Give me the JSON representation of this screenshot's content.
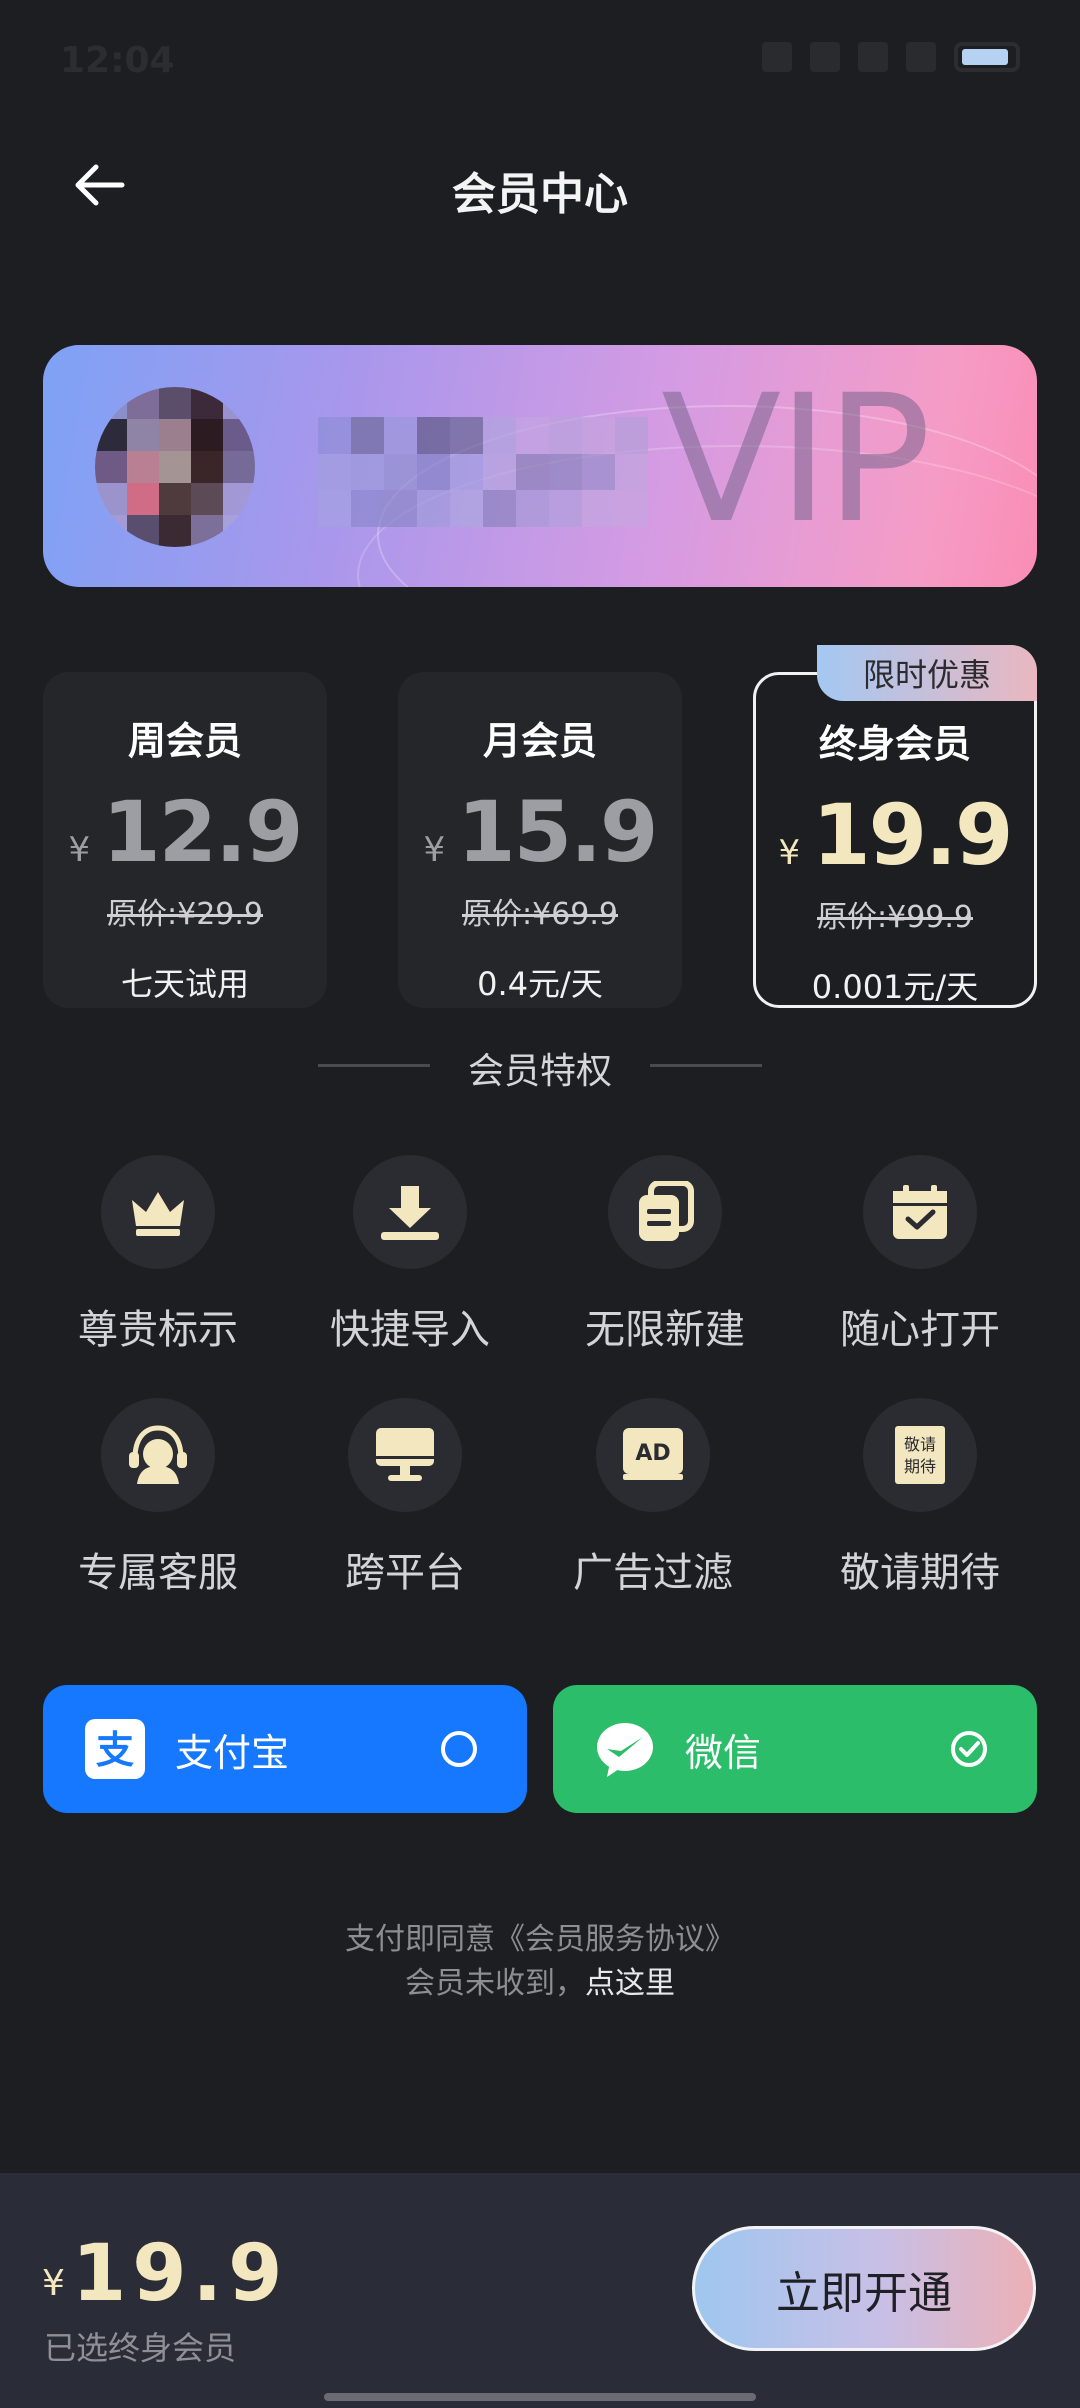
{
  "status_bar": {
    "time": "12:04"
  },
  "header": {
    "title": "会员中心"
  },
  "banner": {
    "vip_text": "VIP"
  },
  "plans": [
    {
      "name": "周会员",
      "yen": "¥",
      "price": "12.9",
      "original": "原价:¥29.9",
      "unit": "七天试用",
      "selected": false
    },
    {
      "name": "月会员",
      "yen": "¥",
      "price": "15.9",
      "original": "原价:¥69.9",
      "unit": "0.4元/天",
      "selected": false
    },
    {
      "name": "终身会员",
      "yen": "¥",
      "price": "19.9",
      "original": "原价:¥99.9",
      "unit": "0.001元/天",
      "selected": true
    }
  ],
  "promo_badge": "限时优惠",
  "privileges": {
    "title": "会员特权",
    "items": [
      {
        "label": "尊贵标示",
        "icon": "crown-icon"
      },
      {
        "label": "快捷导入",
        "icon": "import-icon"
      },
      {
        "label": "无限新建",
        "icon": "documents-icon"
      },
      {
        "label": "随心打开",
        "icon": "calendar-check-icon"
      },
      {
        "label": "专属客服",
        "icon": "headset-icon"
      },
      {
        "label": "跨平台",
        "icon": "monitor-icon"
      },
      {
        "label": "广告过滤",
        "icon": "ad-icon"
      },
      {
        "label": "敬请期待",
        "icon": "coming-soon-icon",
        "icon_text": "敬请\n期待"
      }
    ]
  },
  "payment": {
    "alipay": {
      "label": "支付宝",
      "selected": false,
      "color": "#1677ff"
    },
    "wechat": {
      "label": "微信",
      "selected": true,
      "color": "#2bbd6a"
    }
  },
  "agreement": {
    "line1": "支付即同意《会员服务协议》",
    "line2_prefix": "会员未收到，",
    "line2_link": "点这里"
  },
  "footer": {
    "yen": "¥",
    "total": "19.9",
    "selected_plan": "已选终身会员",
    "subscribe_label": "立即开通"
  },
  "colors": {
    "accent_gold": "#f3e7bf",
    "background": "#1d1e22"
  }
}
